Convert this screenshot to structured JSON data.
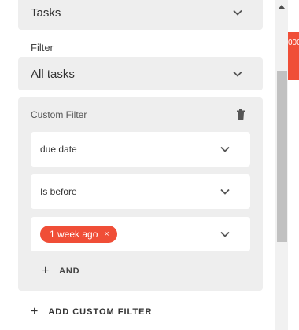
{
  "type_select": {
    "value": "Tasks"
  },
  "filter": {
    "label": "Filter",
    "value": "All tasks"
  },
  "custom_filter": {
    "title": "Custom Filter",
    "field_value": "due date",
    "operator_value": "Is before",
    "chip_label": "1 week ago",
    "chip_remove": "×",
    "and_label": "AND"
  },
  "add_custom_filter_label": "ADD CUSTOM FILTER",
  "plus_glyph": "+",
  "background_badge_text": "000",
  "colors": {
    "accent_red": "#f04e37",
    "panel_gray": "#eeeeee"
  }
}
